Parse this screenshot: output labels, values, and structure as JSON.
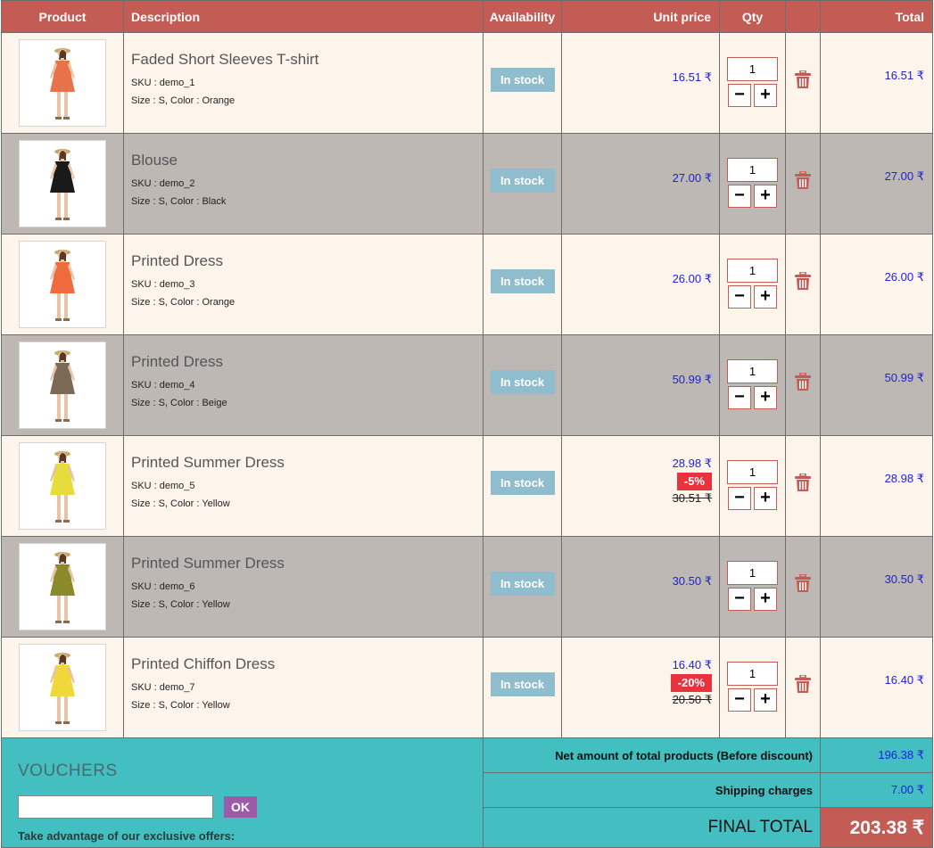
{
  "headers": {
    "product": "Product",
    "description": "Description",
    "availability": "Availability",
    "unit_price": "Unit price",
    "qty": "Qty",
    "delete": "",
    "total": "Total"
  },
  "items": [
    {
      "name": "Faded Short Sleeves T-shirt",
      "sku": "SKU : demo_1",
      "attrs": "Size : S, Color : Orange",
      "availability": "In stock",
      "unit_price": "16.51 ₹",
      "discount": "",
      "old_price": "",
      "qty": "1",
      "total": "16.51 ₹",
      "dress_color": "#e8734a"
    },
    {
      "name": "Blouse",
      "sku": "SKU : demo_2",
      "attrs": "Size : S, Color : Black",
      "availability": "In stock",
      "unit_price": "27.00 ₹",
      "discount": "",
      "old_price": "",
      "qty": "1",
      "total": "27.00 ₹",
      "dress_color": "#1a1a1a"
    },
    {
      "name": "Printed Dress",
      "sku": "SKU : demo_3",
      "attrs": "Size : S, Color : Orange",
      "availability": "In stock",
      "unit_price": "26.00 ₹",
      "discount": "",
      "old_price": "",
      "qty": "1",
      "total": "26.00 ₹",
      "dress_color": "#ef6a3d"
    },
    {
      "name": "Printed Dress",
      "sku": "SKU : demo_4",
      "attrs": "Size : S, Color : Beige",
      "availability": "In stock",
      "unit_price": "50.99 ₹",
      "discount": "",
      "old_price": "",
      "qty": "1",
      "total": "50.99 ₹",
      "dress_color": "#7a6a55"
    },
    {
      "name": "Printed Summer Dress",
      "sku": "SKU : demo_5",
      "attrs": "Size : S, Color : Yellow",
      "availability": "In stock",
      "unit_price": "28.98 ₹",
      "discount": "-5%",
      "old_price": "30.51 ₹",
      "qty": "1",
      "total": "28.98 ₹",
      "dress_color": "#e6dc3c"
    },
    {
      "name": "Printed Summer Dress",
      "sku": "SKU : demo_6",
      "attrs": "Size : S, Color : Yellow",
      "availability": "In stock",
      "unit_price": "30.50 ₹",
      "discount": "",
      "old_price": "",
      "qty": "1",
      "total": "30.50 ₹",
      "dress_color": "#8a8a2a"
    },
    {
      "name": "Printed Chiffon Dress",
      "sku": "SKU : demo_7",
      "attrs": "Size : S, Color : Yellow",
      "availability": "In stock",
      "unit_price": "16.40 ₹",
      "discount": "-20%",
      "old_price": "20.50 ₹",
      "qty": "1",
      "total": "16.40 ₹",
      "dress_color": "#f0d83a"
    }
  ],
  "qty_minus": "−",
  "qty_plus": "+",
  "vouchers": {
    "title": "VOUCHERS",
    "input_value": "",
    "ok_label": "OK",
    "note": "Take advantage of our exclusive offers:"
  },
  "summary": {
    "net_label": "Net amount of total products (Before discount)",
    "net_value": "196.38 ₹",
    "shipping_label": "Shipping charges",
    "shipping_value": "7.00 ₹",
    "final_label": "FINAL TOTAL",
    "final_value": "203.38 ₹"
  },
  "colors": {
    "header": "#c45c56",
    "odd_row": "#fdf5ec",
    "even_row": "#bdb8b4",
    "stock_badge": "#8fbdcd",
    "price": "#1e22d8",
    "discount_badge": "#e8323e",
    "footer": "#43bfc1",
    "ok_button": "#9b5ba9"
  }
}
